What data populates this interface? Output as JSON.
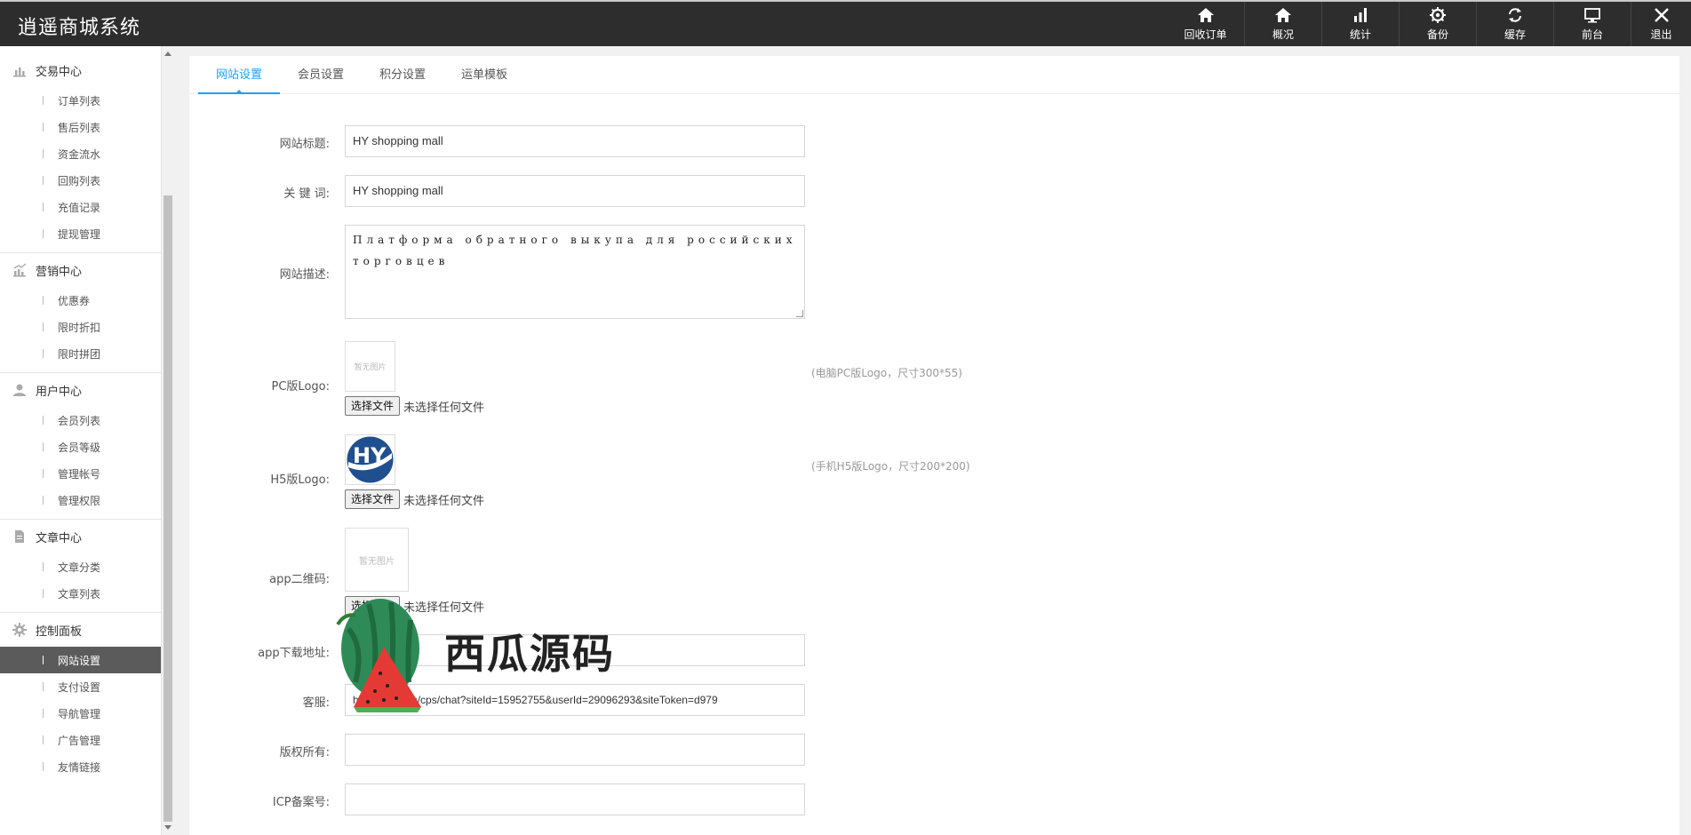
{
  "app": {
    "title": "逍遥商城系统"
  },
  "topnav": [
    {
      "label": "回收订单",
      "icon": "home-icon"
    },
    {
      "label": "概况",
      "icon": "home-icon"
    },
    {
      "label": "统计",
      "icon": "bar-chart-icon"
    },
    {
      "label": "备份",
      "icon": "gear-icon"
    },
    {
      "label": "缓存",
      "icon": "refresh-icon"
    },
    {
      "label": "前台",
      "icon": "monitor-icon"
    },
    {
      "label": "退出",
      "icon": "close-icon"
    }
  ],
  "sidebar": {
    "groups": [
      {
        "title": "交易中心",
        "icon": "bar-chart-icon",
        "items": [
          "订单列表",
          "售后列表",
          "资金流水",
          "回购列表",
          "充值记录",
          "提现管理"
        ]
      },
      {
        "title": "营销中心",
        "icon": "chart-icon",
        "items": [
          "优惠券",
          "限时折扣",
          "限时拼团"
        ]
      },
      {
        "title": "用户中心",
        "icon": "user-icon",
        "items": [
          "会员列表",
          "会员等级",
          "管理帐号",
          "管理权限"
        ]
      },
      {
        "title": "文章中心",
        "icon": "document-icon",
        "items": [
          "文章分类",
          "文章列表"
        ]
      },
      {
        "title": "控制面板",
        "icon": "gear-icon",
        "items": [
          "网站设置",
          "支付设置",
          "导航管理",
          "广告管理",
          "友情链接"
        ],
        "active": "网站设置"
      }
    ]
  },
  "tabs": [
    "网站设置",
    "会员设置",
    "积分设置",
    "运单模板"
  ],
  "form": {
    "site_title": {
      "label": "网站标题:",
      "value": "HY shopping mall"
    },
    "keywords": {
      "label": "关 键 词:",
      "value": "HY shopping mall"
    },
    "description": {
      "label": "网站描述:",
      "value": "Платформа обратного выкупа для российских торговцев"
    },
    "pc_logo": {
      "label": "PC版Logo:",
      "placeholder": "暂无图片",
      "hint": "(电脑PC版Logo，尺寸300*55)"
    },
    "h5_logo": {
      "label": "H5版Logo:",
      "hint": "(手机H5版Logo，尺寸200*200)"
    },
    "app_qr": {
      "label": "app二维码:",
      "placeholder": "暂无图片"
    },
    "file_button": "选择文件",
    "file_none": "未选择任何文件",
    "app_url": {
      "label": "app下载地址:",
      "value": ""
    },
    "service": {
      "label": "客服:",
      "value": "http://            du.com/cps/chat?siteId=15952755&userId=29096293&siteToken=d979"
    },
    "copyright": {
      "label": "版权所有:",
      "value": ""
    },
    "icp": {
      "label": "ICP备案号:",
      "value": ""
    }
  },
  "watermark": {
    "text": "西瓜源码"
  },
  "colors": {
    "accent": "#1e9fff",
    "topbar": "#2d2d2d",
    "active_menu": "#5b5b5b"
  }
}
